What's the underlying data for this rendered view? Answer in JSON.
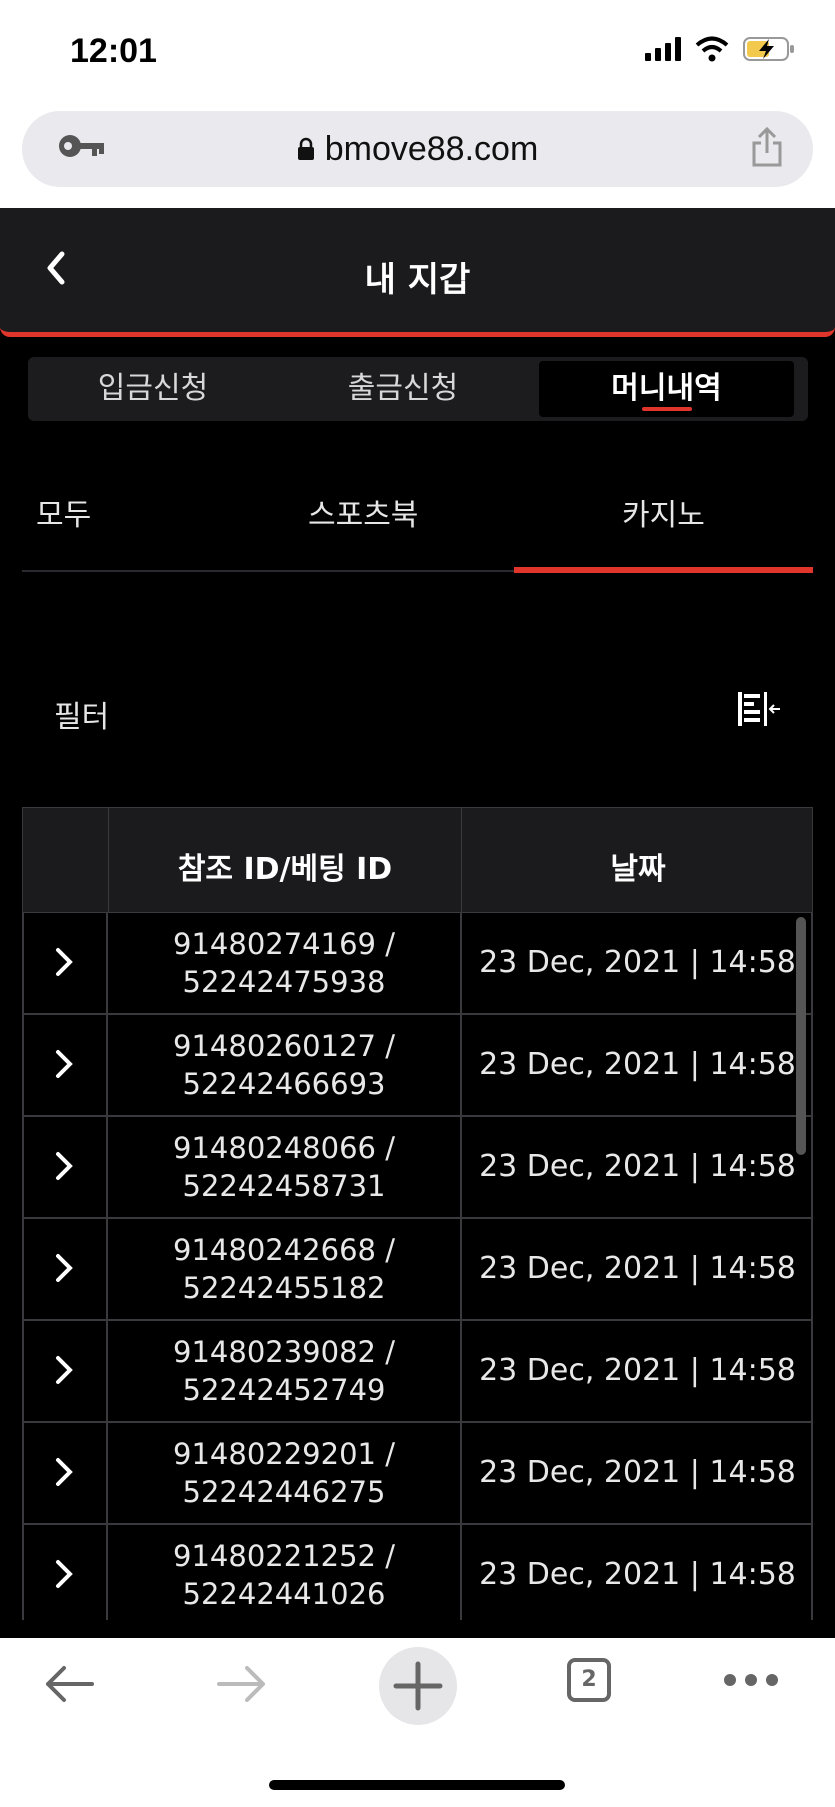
{
  "status_bar": {
    "time": "12:01"
  },
  "browser": {
    "url": "bmove88.com",
    "tab_count": "2"
  },
  "header": {
    "title": "내 지갑"
  },
  "segments": [
    {
      "label": "입금신청",
      "active": false
    },
    {
      "label": "출금신청",
      "active": false
    },
    {
      "label": "머니내역",
      "active": true
    }
  ],
  "subtabs": [
    {
      "label": "모두"
    },
    {
      "label": "스포츠북"
    },
    {
      "label": "카지노",
      "active": true
    }
  ],
  "filter": {
    "label": "필터"
  },
  "table": {
    "columns": [
      "참조 ID/베팅 ID",
      "날짜"
    ],
    "rows": [
      {
        "ref_id": "91480274169 /",
        "bet_id": "52242475938",
        "date": "23 Dec, 2021 | 14:58"
      },
      {
        "ref_id": "91480260127 /",
        "bet_id": "52242466693",
        "date": "23 Dec, 2021 | 14:58"
      },
      {
        "ref_id": "91480248066 /",
        "bet_id": "52242458731",
        "date": "23 Dec, 2021 | 14:58"
      },
      {
        "ref_id": "91480242668 /",
        "bet_id": "52242455182",
        "date": "23 Dec, 2021 | 14:58"
      },
      {
        "ref_id": "91480239082 /",
        "bet_id": "52242452749",
        "date": "23 Dec, 2021 | 14:58"
      },
      {
        "ref_id": "91480229201 /",
        "bet_id": "52242446275",
        "date": "23 Dec, 2021 | 14:58"
      },
      {
        "ref_id": "91480221252 /",
        "bet_id": "52242441026",
        "date": "23 Dec, 2021 | 14:58"
      }
    ]
  },
  "colors": {
    "accent": "#e0352b",
    "background": "#000000",
    "header_bg": "#1b1b1e"
  }
}
